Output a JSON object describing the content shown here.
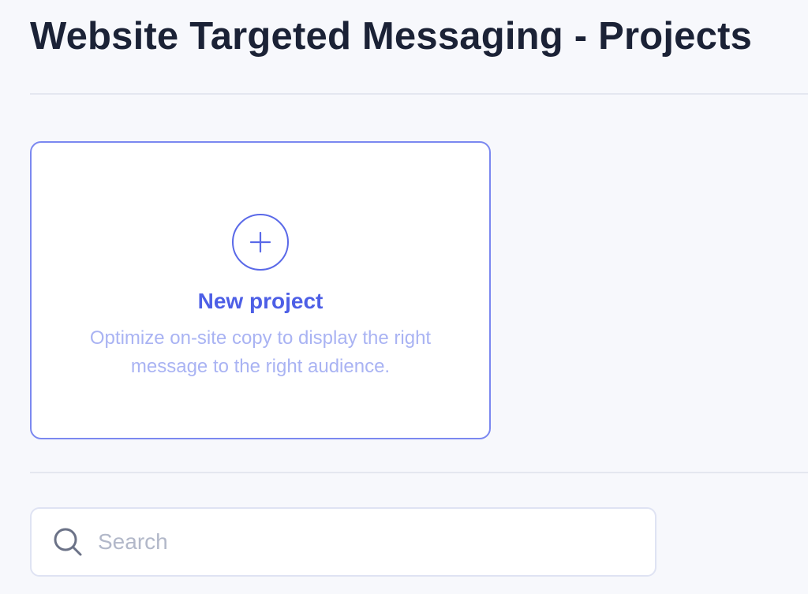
{
  "page": {
    "title": "Website Targeted Messaging - Projects"
  },
  "new_project_card": {
    "title": "New project",
    "description": "Optimize on-site copy to display the right message to the right audience.",
    "icon": "plus-icon"
  },
  "search": {
    "placeholder": "Search",
    "value": "",
    "icon": "search-icon"
  },
  "colors": {
    "background": "#f7f8fc",
    "title_text": "#1b2236",
    "accent": "#4d5fe6",
    "card_border": "#7b88f0",
    "description_text": "#a9b3f3",
    "divider": "#e4e7f0",
    "search_border": "#dfe3f3",
    "placeholder_text": "#b2b8c9"
  }
}
